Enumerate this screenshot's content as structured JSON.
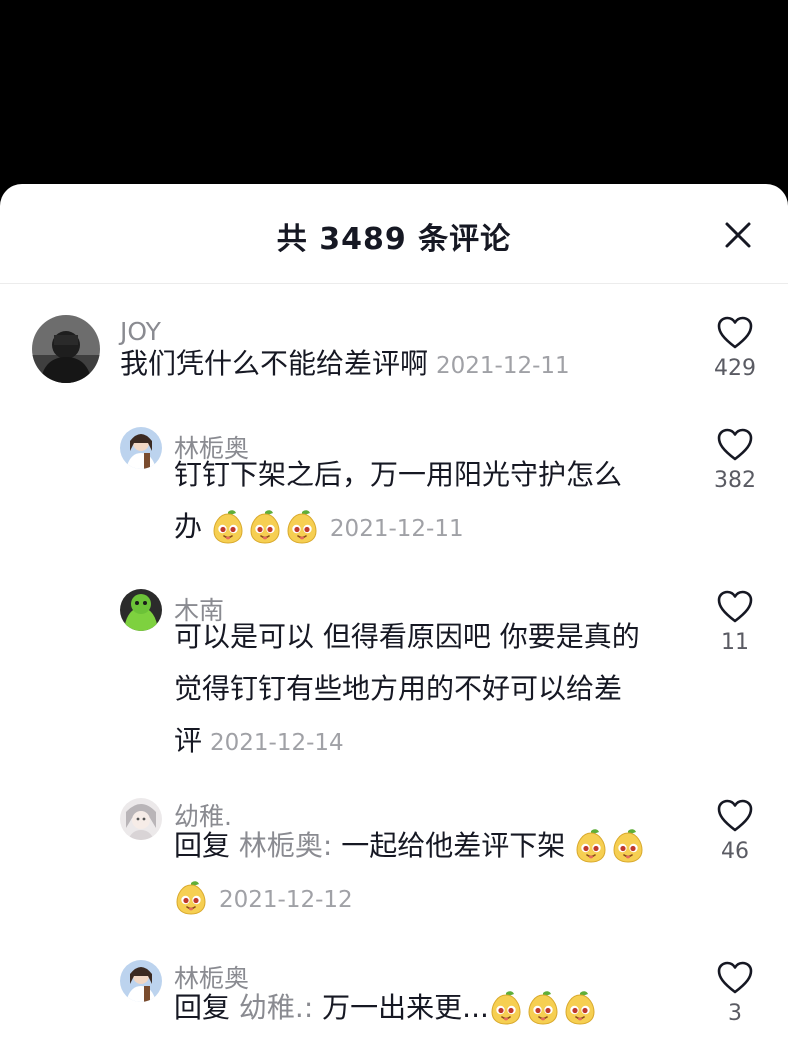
{
  "header": {
    "title": "共 3489 条评论",
    "close_icon": "close-icon"
  },
  "comments": [
    {
      "author": "JOY",
      "text": "我们凭什么不能给差评啊",
      "date": "2021-12-11",
      "likes": "429",
      "avatar": "dark-avatar"
    },
    {
      "author": "林栀奥",
      "text": "钉钉下架之后，万一用阳光守护怎么办",
      "text_line1": "钉钉下架之后，万一用阳光守护怎么",
      "text_line2": "办",
      "emoji_count": 3,
      "date": "2021-12-11",
      "likes": "382",
      "avatar": "girl-avatar"
    },
    {
      "author": "木南",
      "text_line1": "可以是可以 但得看原因吧 你要是真的",
      "text_line2": "觉得钉钉有些地方用的不好可以给差",
      "text_line3": "评",
      "date": "2021-12-14",
      "likes": "11",
      "avatar": "green-avatar"
    },
    {
      "author": "幼稚.",
      "reply_prefix": "回复",
      "reply_target": "林栀奥:",
      "text": "一起给他差评下架",
      "emoji_count": 3,
      "date": "2021-12-12",
      "likes": "46",
      "avatar": "face-avatar"
    },
    {
      "author": "林栀奥",
      "reply_prefix": "回复",
      "reply_target": "幼稚.:",
      "text": "万一出来更...",
      "emoji_count": 3,
      "likes": "3",
      "avatar": "girl-avatar"
    }
  ],
  "icons": {
    "like": "heart-icon",
    "emoji": "pear-emoji-icon"
  },
  "colors": {
    "text": "#161823",
    "secondary": "#8a8b91",
    "date": "#a0a1a6",
    "background": "#ffffff",
    "backdrop": "#000000"
  }
}
